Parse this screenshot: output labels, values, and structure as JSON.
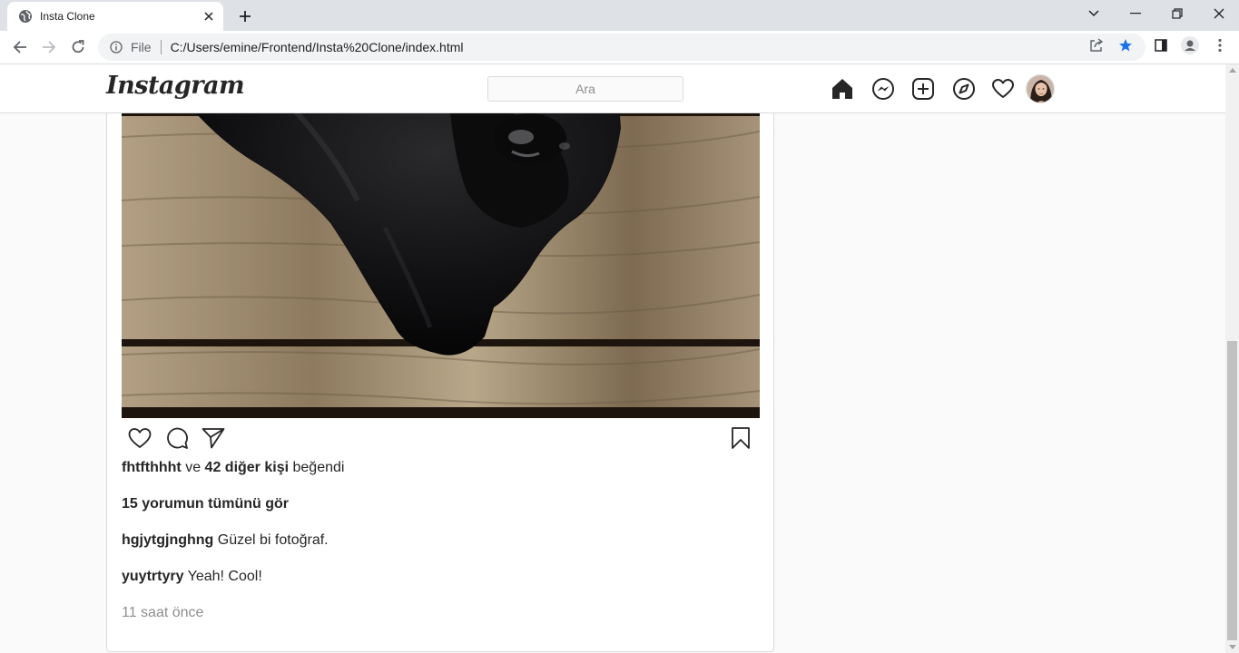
{
  "browser": {
    "tab_title": "Insta Clone",
    "scheme_label": "File",
    "url": "C:/Users/emine/Frontend/Insta%20Clone/index.html"
  },
  "header": {
    "logo": "Instagram",
    "search_placeholder": "Ara"
  },
  "post": {
    "liked_by_user": "fhtfthhht",
    "liked_connector": "ve",
    "liked_others": "42 diğer kişi",
    "liked_suffix": "beğendi",
    "view_all_comments": "15 yorumun tümünü gör",
    "comments": [
      {
        "user": "hgjytgjnghng",
        "text": "Güzel bi fotoğraf."
      },
      {
        "user": "yuytrtyry",
        "text": "Yeah! Cool!"
      }
    ],
    "timestamp": "11 saat önce"
  },
  "icons": {
    "nav": [
      "home-icon",
      "messenger-icon",
      "new-post-icon",
      "explore-icon",
      "activity-heart-icon",
      "avatar"
    ],
    "actions": [
      "like-heart-icon",
      "comment-icon",
      "share-icon",
      "bookmark-icon"
    ]
  },
  "colors": {
    "text": "#262626",
    "muted": "#8e8e8e",
    "border": "#dbdbdb",
    "accent_star": "#1a73e8"
  }
}
